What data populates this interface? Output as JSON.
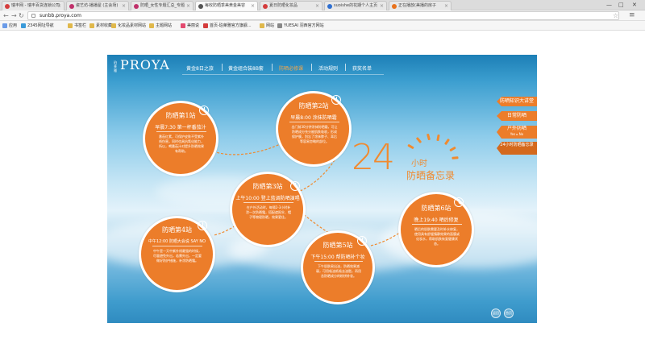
{
  "browser": {
    "tabs": [
      {
        "label": "瑞丰网 - 瑞丰百货连锁公司",
        "color": "#d43c3c"
      },
      {
        "label": "瓷艺坊-播播屋 (主会场)",
        "color": "#c0306a"
      },
      {
        "label": "防晒_女性专题汇总_专题",
        "color": "#c0306a"
      },
      {
        "label": "每收防晒季美黄金美容",
        "color": "#555555"
      },
      {
        "label": "夏日防晒化妆品",
        "color": "#d43c3c"
      },
      {
        "label": "suoishe的花期个人主页",
        "color": "#2f6fd0"
      },
      {
        "label": "正在播放(美播的房子",
        "color": "#e8721c"
      }
    ],
    "url": "sunbb.proya.com",
    "bookmarks": [
      {
        "label": "应用",
        "color": "#6a9be8"
      },
      {
        "label": "2345网址导航",
        "color": "#3a9ad9"
      },
      {
        "label": "书签栏",
        "color": "#e0b84b"
      },
      {
        "label": "素材收藏",
        "color": "#e0b84b"
      },
      {
        "label": "化妆品素材网站",
        "color": "#e0b84b"
      },
      {
        "label": "主题网站",
        "color": "#e0b84b"
      },
      {
        "label": "美丽说",
        "color": "#e34a6f"
      },
      {
        "label": "首页-珀莱雅官方旗舰...",
        "color": "#d43c3c"
      },
      {
        "label": "网站",
        "color": "#e0b84b"
      },
      {
        "label": "YUESAI 羽西官方网站",
        "color": "#888888"
      }
    ],
    "window_controls": {
      "minimize": "—",
      "maximize": "□",
      "close": "✕"
    }
  },
  "site": {
    "brand_small": "珀莱雅",
    "brand": "PROYA",
    "nav": [
      {
        "label": "黄金8日之旅",
        "active": false
      },
      {
        "label": "黄金组合装8B套",
        "active": false
      },
      {
        "label": "防晒必修课",
        "active": true
      },
      {
        "label": "活动规则",
        "active": false
      },
      {
        "label": "获奖名单",
        "active": false
      }
    ],
    "side_tabs": [
      {
        "label": "防晒知识大讲堂",
        "sub": ""
      },
      {
        "label": "日常防晒",
        "sub": ""
      },
      {
        "label": "户外防晒",
        "sub": "Yes ▸ No"
      },
      {
        "label": "24小时防晒备忘录",
        "sub": ""
      }
    ],
    "headline": {
      "num": "24",
      "unit": "小时",
      "title": "防晒备忘录"
    },
    "stations": [
      {
        "title": "防晒第1站",
        "time": "早晨7:30 第一杯番茄汁",
        "text": "番茄红素，可保护皮肤不受紫外线伤害，同时也具抗氧化能力，所以，喝番茄汁对提升防晒效果有帮助。"
      },
      {
        "title": "防晒第2站",
        "time": "早晨8:00 涂抹防晒霜",
        "text": "出门前30分钟涂抹防晒霜，可让防晒成分充分被肌肤吸收，形成保护膜，别忘了涂抹脖子、耳后等容易忽略的部位。"
      },
      {
        "title": "防晒第3站",
        "time": "上午10:00 登上蓝调防晒演唱",
        "text": "在户外活动时，每隔2-3小时补涂一次防晒霜，搭配遮阳伞、帽子等物理防晒，效果更佳。"
      },
      {
        "title": "防晒第4站",
        "time": "中午12:00 防晒大会说 SAY NO",
        "text": "中午是一天中紫外线最强的时候，尽量避免外出，若需外出，一定要做好防护措施，补涂防晒霜。"
      },
      {
        "title": "防晒第5站",
        "time": "下午15:00 帮防晒补个妆",
        "text": "下午肌肤易出油，防晒效果减弱，可用吸油纸吸去油脂，再用含防晒成分的粉饼补妆。"
      },
      {
        "title": "防晒第6站",
        "time": "晚上19:40 晒后修复",
        "text": "晒后的肌肤需要及时补水修复，使用具有舒缓镇静效果的面膜或化妆水，帮助肌肤恢复健康状态。"
      }
    ],
    "bottom_buttons": [
      "返回",
      "首页"
    ]
  }
}
